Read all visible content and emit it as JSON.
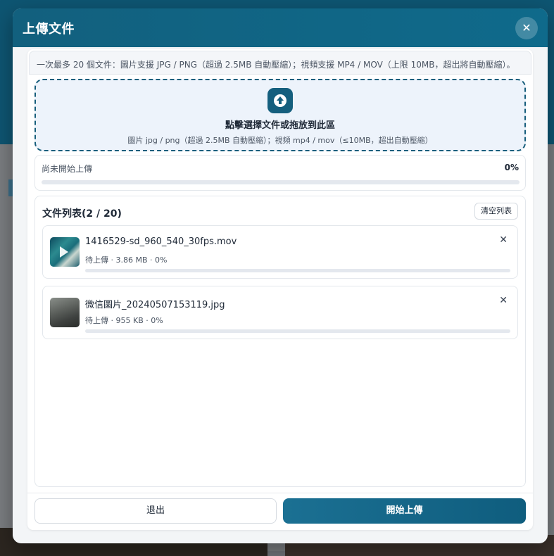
{
  "modal": {
    "title": "上傳文件",
    "close_icon": "close-icon"
  },
  "notice": {
    "text": "一次最多 20 個文件：圖片支援 JPG / PNG（超過 2.5MB 自動壓縮）；視頻支援 MP4 / MOV（上限 10MB，超出將自動壓縮）。"
  },
  "dropzone": {
    "icon": "upload-arrow-icon",
    "title": "點擊選擇文件或拖放到此區",
    "subtitle": "圖片 jpg / png（超過 2.5MB 自動壓縮）；視頻 mp4 / mov（≤10MB，超出自動壓縮）"
  },
  "overall_progress": {
    "status": "尚未開始上傳",
    "percent_label": "0%",
    "value": 0
  },
  "file_list": {
    "title": "文件列表(2 / 20)",
    "clear_label": "清空列表",
    "items": [
      {
        "name": "1416529-sd_960_540_30fps.mov",
        "meta": "待上傳 · 3.86 MB · 0%",
        "type": "video",
        "progress": 0
      },
      {
        "name": "微信圖片_20240507153119.jpg",
        "meta": "待上傳 · 955 KB · 0%",
        "type": "image",
        "progress": 0
      }
    ]
  },
  "footer": {
    "exit_label": "退出",
    "start_label": "開始上傳"
  },
  "colors": {
    "primary": "#155f7e",
    "header": "#12607e",
    "dropzone_bg": "#edf3fb"
  }
}
